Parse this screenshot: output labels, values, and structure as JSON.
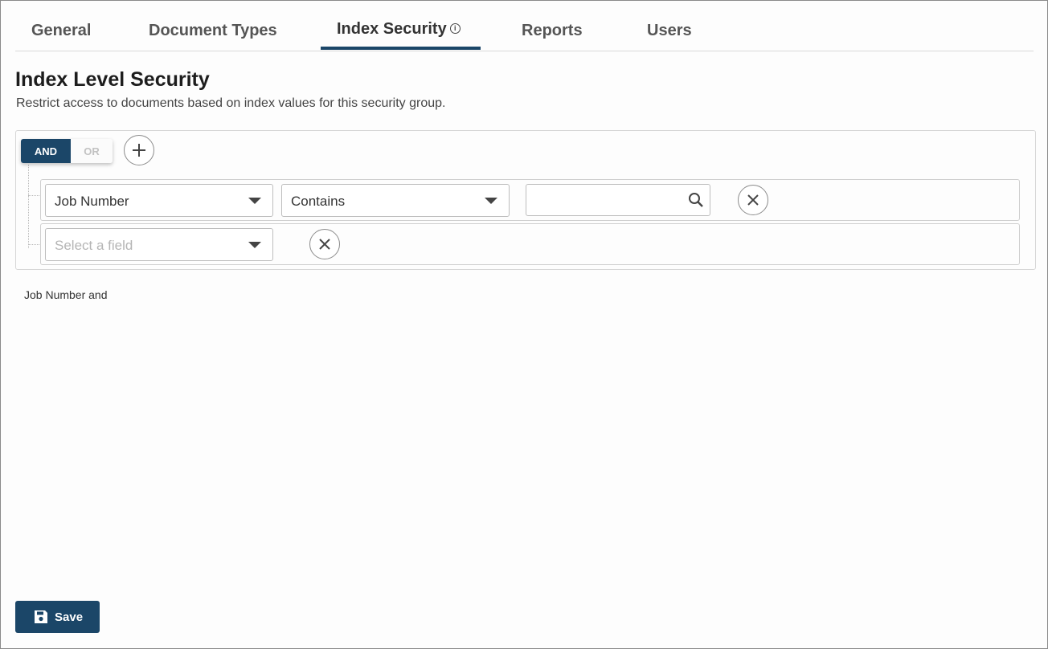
{
  "tabs": [
    {
      "label": "General"
    },
    {
      "label": "Document Types"
    },
    {
      "label": "Index Security",
      "active": true,
      "icon": "info-icon"
    },
    {
      "label": "Reports"
    },
    {
      "label": "Users"
    }
  ],
  "header": {
    "title": "Index Level Security",
    "description": "Restrict access to documents based on index values for this security group."
  },
  "builder": {
    "combinator": {
      "and_label": "AND",
      "or_label": "OR",
      "selected": "AND"
    },
    "add_icon": "plus-icon",
    "rules": [
      {
        "field": "Job Number",
        "operator": "Contains",
        "value": "",
        "value_icon": "search-icon",
        "remove_icon": "close-icon"
      },
      {
        "field_placeholder": "Select a field",
        "remove_icon": "close-icon"
      }
    ],
    "summary": "Job Number and"
  },
  "footer": {
    "save_label": "Save",
    "save_icon": "save-icon"
  },
  "colors": {
    "accent": "#1b4668",
    "border": "#d6d6d6",
    "text": "#333333"
  }
}
